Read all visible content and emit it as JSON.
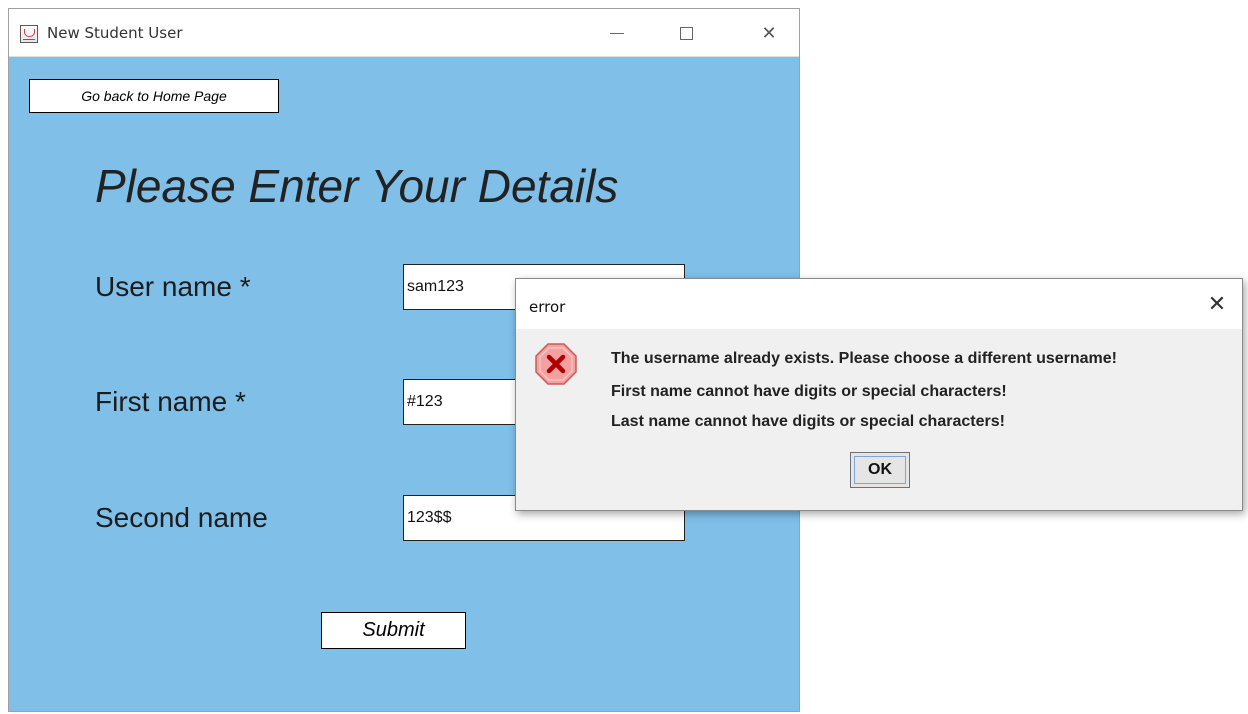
{
  "main_window": {
    "title": "New Student User",
    "back_button_label": "Go back to Home Page",
    "page_title": "Please Enter Your Details",
    "fields": {
      "username": {
        "label": "User name *",
        "value": "sam123"
      },
      "first_name": {
        "label": "First name *",
        "value": "#123"
      },
      "second_name": {
        "label": "Second name",
        "value": "123$$"
      }
    },
    "submit_label": "Submit"
  },
  "dialog": {
    "title": "error",
    "messages": [
      "The username already exists. Please choose a different username!",
      "First name cannot have digits or special characters!",
      "Last name cannot have digits or special characters!"
    ],
    "ok_label": "OK",
    "icon": "error-icon",
    "colors": {
      "icon_fill": "#f2a0a0",
      "icon_x": "#b00000"
    }
  },
  "colors": {
    "form_background": "#7fbfe8"
  }
}
